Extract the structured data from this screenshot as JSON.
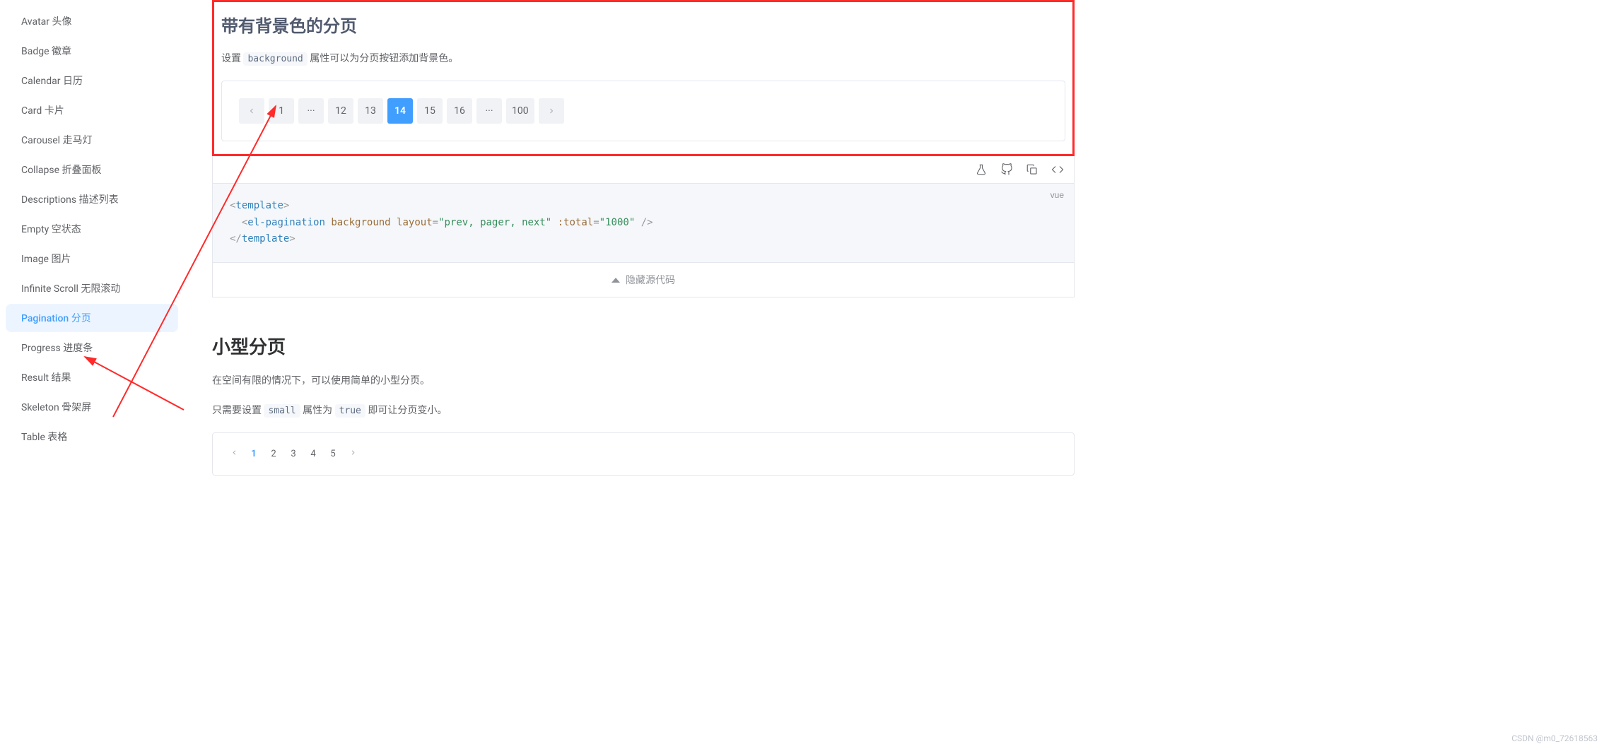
{
  "sidebar": {
    "items": [
      {
        "label": "Avatar 头像"
      },
      {
        "label": "Badge 徽章"
      },
      {
        "label": "Calendar 日历"
      },
      {
        "label": "Card 卡片"
      },
      {
        "label": "Carousel 走马灯"
      },
      {
        "label": "Collapse 折叠面板"
      },
      {
        "label": "Descriptions 描述列表"
      },
      {
        "label": "Empty 空状态"
      },
      {
        "label": "Image 图片"
      },
      {
        "label": "Infinite Scroll 无限滚动"
      },
      {
        "label": "Pagination 分页"
      },
      {
        "label": "Progress 进度条"
      },
      {
        "label": "Result 结果"
      },
      {
        "label": "Skeleton 骨架屏"
      },
      {
        "label": "Table 表格"
      }
    ],
    "active_index": 10
  },
  "section1": {
    "title": "带有背景色的分页",
    "desc_prefix": "设置 ",
    "desc_code": "background",
    "desc_suffix": " 属性可以为分页按钮添加背景色。",
    "pagination": {
      "items": [
        "1",
        "···",
        "12",
        "13",
        "14",
        "15",
        "16",
        "···",
        "100"
      ],
      "active": "14"
    },
    "code": {
      "lang": "vue",
      "tag_open": "template",
      "el": "el-pagination",
      "bg_attr": "background",
      "layout_name": "layout",
      "layout_val": "\"prev, pager, next\"",
      "total_name": ":total",
      "total_val": "\"1000\""
    },
    "hide_source": "隐藏源代码"
  },
  "section2": {
    "title": "小型分页",
    "desc1": "在空间有限的情况下，可以使用简单的小型分页。",
    "desc2_prefix": "只需要设置 ",
    "desc2_code1": "small",
    "desc2_mid": " 属性为 ",
    "desc2_code2": "true",
    "desc2_suffix": " 即可让分页变小。",
    "pagination": {
      "items": [
        "1",
        "2",
        "3",
        "4",
        "5"
      ],
      "active": "1"
    }
  },
  "watermark": "CSDN @m0_72618563"
}
